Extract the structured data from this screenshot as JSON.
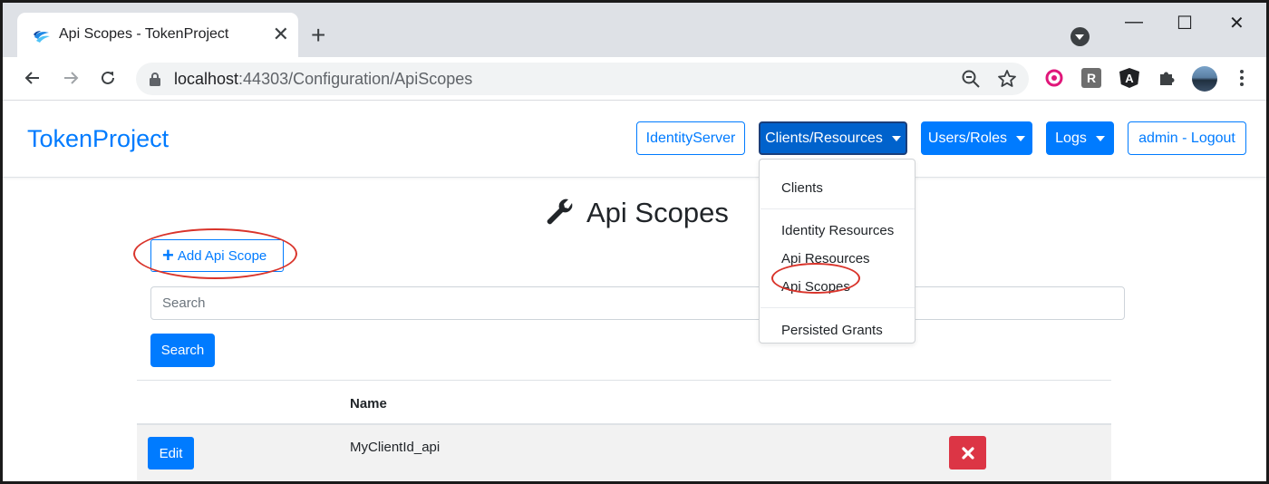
{
  "browser": {
    "tab_title": "Api Scopes - TokenProject",
    "tab_close": "✕",
    "new_tab": "+",
    "url_host": "localhost",
    "url_rest": ":44303/Configuration/ApiScopes",
    "window_controls": [
      "—",
      "☐",
      "✕"
    ],
    "extensions": [
      "redux-devtools-icon",
      "r-extension-icon",
      "angular-devtools-icon",
      "extensions-puzzle-icon",
      "profile-avatar"
    ],
    "extension_labels": {
      "r": "R",
      "angular": "A"
    }
  },
  "nav": {
    "brand": "TokenProject",
    "identity_server": "IdentityServer",
    "clients_resources": "Clients/Resources",
    "users_roles": "Users/Roles",
    "logs": "Logs",
    "logout": "admin - Logout"
  },
  "dropdown": {
    "items": [
      "Clients",
      "Identity Resources",
      "Api Resources",
      "Api Scopes",
      "Persisted Grants"
    ]
  },
  "main": {
    "title": "Api Scopes",
    "add_button": "Add Api Scope",
    "search_placeholder": "Search",
    "search_button": "Search",
    "table": {
      "column_header": "Name",
      "rows": [
        {
          "edit": "Edit",
          "name": "MyClientId_api"
        }
      ]
    }
  },
  "colors": {
    "primary": "#007bff",
    "danger": "#dc3545",
    "annotation": "#d9342b"
  }
}
